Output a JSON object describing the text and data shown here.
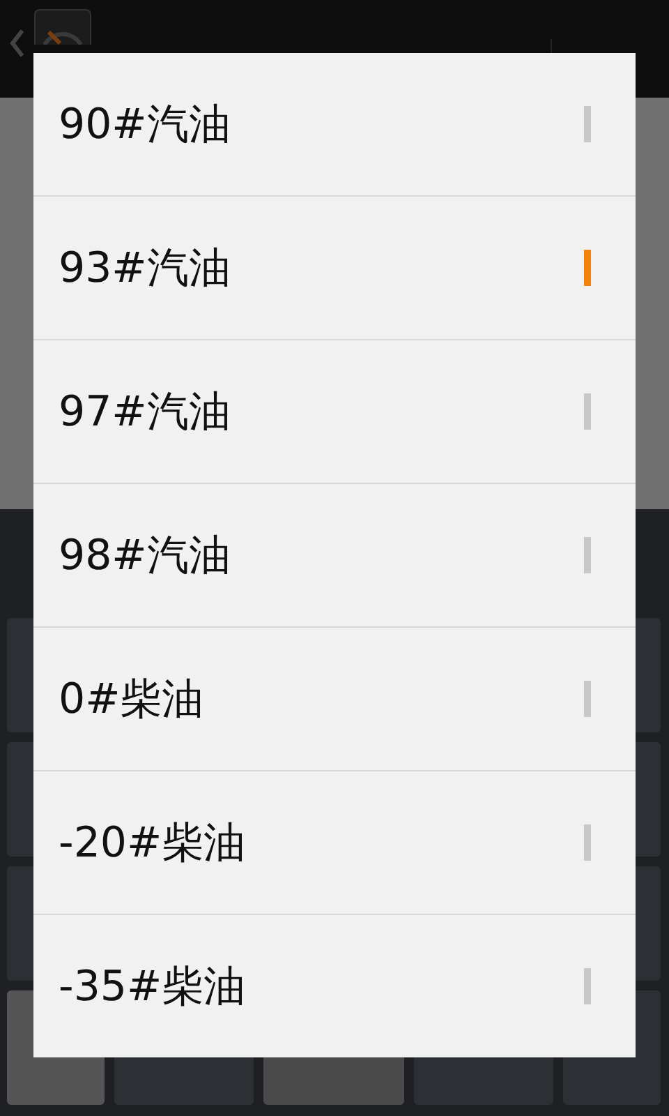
{
  "dialog": {
    "options": [
      {
        "label": "90#汽油",
        "selected": false
      },
      {
        "label": "93#汽油",
        "selected": true
      },
      {
        "label": "97#汽油",
        "selected": false
      },
      {
        "label": "98#汽油",
        "selected": false
      },
      {
        "label": "0#柴油",
        "selected": false
      },
      {
        "label": "-20#柴油",
        "selected": false
      },
      {
        "label": "-35#柴油",
        "selected": false
      }
    ]
  }
}
